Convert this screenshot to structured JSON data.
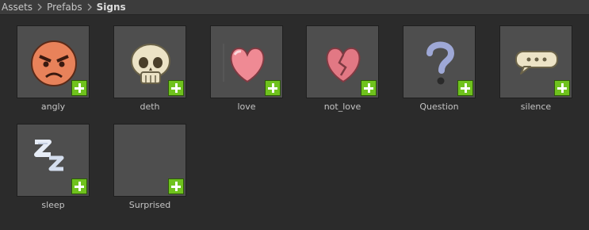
{
  "breadcrumb": {
    "items": [
      "Assets",
      "Prefabs",
      "Signs"
    ]
  },
  "colors": {
    "background": "#2b2b2b",
    "tile": "#4e4e4e",
    "plus_badge": "#6fc21d"
  },
  "assets": [
    {
      "name": "angly",
      "icon": "angry-face-icon"
    },
    {
      "name": "deth",
      "icon": "skull-icon"
    },
    {
      "name": "love",
      "icon": "heart-icon"
    },
    {
      "name": "not_love",
      "icon": "broken-heart-icon"
    },
    {
      "name": "Question",
      "icon": "question-mark-icon"
    },
    {
      "name": "silence",
      "icon": "speech-bubble-icon"
    },
    {
      "name": "sleep",
      "icon": "sleep-zzz-icon"
    },
    {
      "name": "Surprised",
      "icon": "empty-thumbnail"
    }
  ]
}
